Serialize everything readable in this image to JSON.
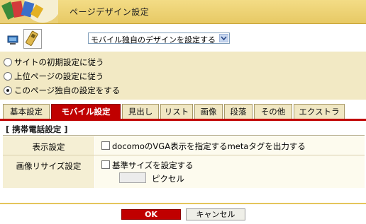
{
  "header": {
    "title": "ページデザイン設定"
  },
  "device": {
    "pc_icon": "pc-icon",
    "mobile_icon": "mobile-phone-icon"
  },
  "design_select": {
    "selected": "モバイル独自のデザインを設定する"
  },
  "radio_options": [
    {
      "label": "サイトの初期設定に従う",
      "checked": false
    },
    {
      "label": "上位ページの設定に従う",
      "checked": false
    },
    {
      "label": "このページ独自の設定をする",
      "checked": true
    }
  ],
  "tabs": [
    {
      "label": "基本設定",
      "active": false
    },
    {
      "label": "モバイル設定",
      "active": true
    },
    {
      "label": "見出し",
      "active": false
    },
    {
      "label": "リスト",
      "active": false
    },
    {
      "label": "画像",
      "active": false
    },
    {
      "label": "段落",
      "active": false
    },
    {
      "label": "その他",
      "active": false
    },
    {
      "label": "エクストラ",
      "active": false
    }
  ],
  "section": {
    "title": "[ 携帯電話設定 ]",
    "rows": [
      {
        "label": "表示設定",
        "checkbox_label": "docomoのVGA表示を指定するmetaタグを出力する",
        "checked": false
      },
      {
        "label": "画像リサイズ設定",
        "checkbox_label": "基準サイズを設定する",
        "checked": false,
        "input_value": "",
        "unit": "ピクセル"
      }
    ]
  },
  "buttons": {
    "ok": "OK",
    "cancel": "キャンセル"
  },
  "colors": {
    "accent": "#c00000",
    "tab_bg": "#f0e7c3",
    "panel_bg": "#f2e9c4"
  }
}
